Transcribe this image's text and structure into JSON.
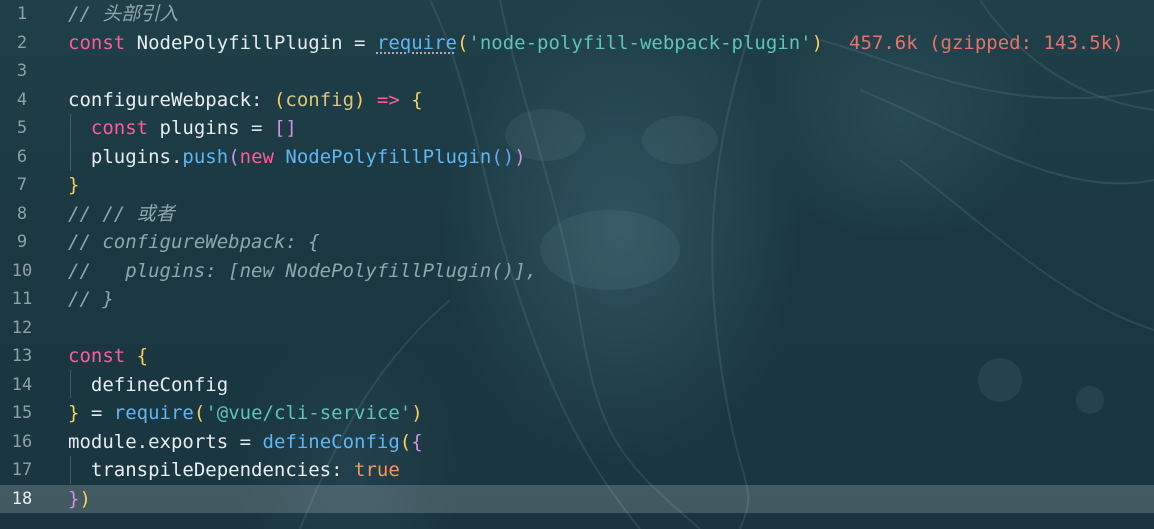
{
  "editor": {
    "lines": [
      {
        "num": "1",
        "tokens": [
          {
            "t": "// 头部引入",
            "c": "cmt"
          }
        ]
      },
      {
        "num": "2",
        "tokens": [
          {
            "t": "const ",
            "c": "kw"
          },
          {
            "t": "NodePolyfillPlugin",
            "c": "id"
          },
          {
            "t": " = ",
            "c": "punc"
          },
          {
            "t": "require",
            "c": "fn underl"
          },
          {
            "t": "(",
            "c": "br1"
          },
          {
            "t": "'node-polyfill-webpack-plugin'",
            "c": "str"
          },
          {
            "t": ")",
            "c": "br1"
          }
        ],
        "hint": "457.6k (gzipped: 143.5k)"
      },
      {
        "num": "3",
        "tokens": []
      },
      {
        "num": "4",
        "tokens": [
          {
            "t": "configureWebpack",
            "c": "prop"
          },
          {
            "t": ": ",
            "c": "punc"
          },
          {
            "t": "(",
            "c": "br1"
          },
          {
            "t": "config",
            "c": "param"
          },
          {
            "t": ")",
            "c": "br1"
          },
          {
            "t": " => ",
            "c": "kw"
          },
          {
            "t": "{",
            "c": "br1"
          }
        ]
      },
      {
        "num": "5",
        "tokens": [
          {
            "t": "  ",
            "c": "punc"
          },
          {
            "t": "const ",
            "c": "kw"
          },
          {
            "t": "plugins",
            "c": "id"
          },
          {
            "t": " = ",
            "c": "punc"
          },
          {
            "t": "[]",
            "c": "br2"
          }
        ]
      },
      {
        "num": "6",
        "tokens": [
          {
            "t": "  ",
            "c": "punc"
          },
          {
            "t": "plugins",
            "c": "id"
          },
          {
            "t": ".",
            "c": "punc"
          },
          {
            "t": "push",
            "c": "fn"
          },
          {
            "t": "(",
            "c": "br2"
          },
          {
            "t": "new ",
            "c": "kw"
          },
          {
            "t": "NodePolyfillPlugin",
            "c": "fn"
          },
          {
            "t": "()",
            "c": "br3"
          },
          {
            "t": ")",
            "c": "br2"
          }
        ]
      },
      {
        "num": "7",
        "tokens": [
          {
            "t": "}",
            "c": "br1"
          }
        ]
      },
      {
        "num": "8",
        "tokens": [
          {
            "t": "// // 或者",
            "c": "cmt"
          }
        ]
      },
      {
        "num": "9",
        "tokens": [
          {
            "t": "// configureWebpack: {",
            "c": "cmt"
          }
        ]
      },
      {
        "num": "10",
        "tokens": [
          {
            "t": "//   plugins: [new NodePolyfillPlugin()],",
            "c": "cmt"
          }
        ]
      },
      {
        "num": "11",
        "tokens": [
          {
            "t": "// }",
            "c": "cmt"
          }
        ]
      },
      {
        "num": "12",
        "tokens": []
      },
      {
        "num": "13",
        "tokens": [
          {
            "t": "const ",
            "c": "kw"
          },
          {
            "t": "{",
            "c": "br1"
          }
        ]
      },
      {
        "num": "14",
        "tokens": [
          {
            "t": "  ",
            "c": "punc"
          },
          {
            "t": "defineConfig",
            "c": "id"
          }
        ]
      },
      {
        "num": "15",
        "tokens": [
          {
            "t": "}",
            "c": "br1"
          },
          {
            "t": " = ",
            "c": "punc"
          },
          {
            "t": "require",
            "c": "fn"
          },
          {
            "t": "(",
            "c": "br1"
          },
          {
            "t": "'@vue/cli-service'",
            "c": "str"
          },
          {
            "t": ")",
            "c": "br1"
          }
        ]
      },
      {
        "num": "16",
        "tokens": [
          {
            "t": "module",
            "c": "id"
          },
          {
            "t": ".",
            "c": "punc"
          },
          {
            "t": "exports",
            "c": "id"
          },
          {
            "t": " = ",
            "c": "punc"
          },
          {
            "t": "defineConfig",
            "c": "fn"
          },
          {
            "t": "(",
            "c": "br1"
          },
          {
            "t": "{",
            "c": "br2"
          }
        ]
      },
      {
        "num": "17",
        "tokens": [
          {
            "t": "  ",
            "c": "punc"
          },
          {
            "t": "transpileDependencies",
            "c": "prop"
          },
          {
            "t": ": ",
            "c": "punc"
          },
          {
            "t": "true",
            "c": "bool"
          }
        ]
      },
      {
        "num": "18",
        "tokens": [
          {
            "t": "}",
            "c": "br2"
          },
          {
            "t": ")",
            "c": "br1"
          }
        ],
        "active": true
      }
    ]
  },
  "colors": {
    "background": "#1b3842",
    "keyword": "#ff5c9b",
    "function": "#5fb6f3",
    "string": "#5cc5b9",
    "comment": "#8ea7ae",
    "boolean": "#f5965b",
    "import_cost_hint": "#e6736a",
    "bracket_level1": "#f3d25c",
    "bracket_level2": "#d28fe4",
    "bracket_level3": "#5fa9f0"
  }
}
